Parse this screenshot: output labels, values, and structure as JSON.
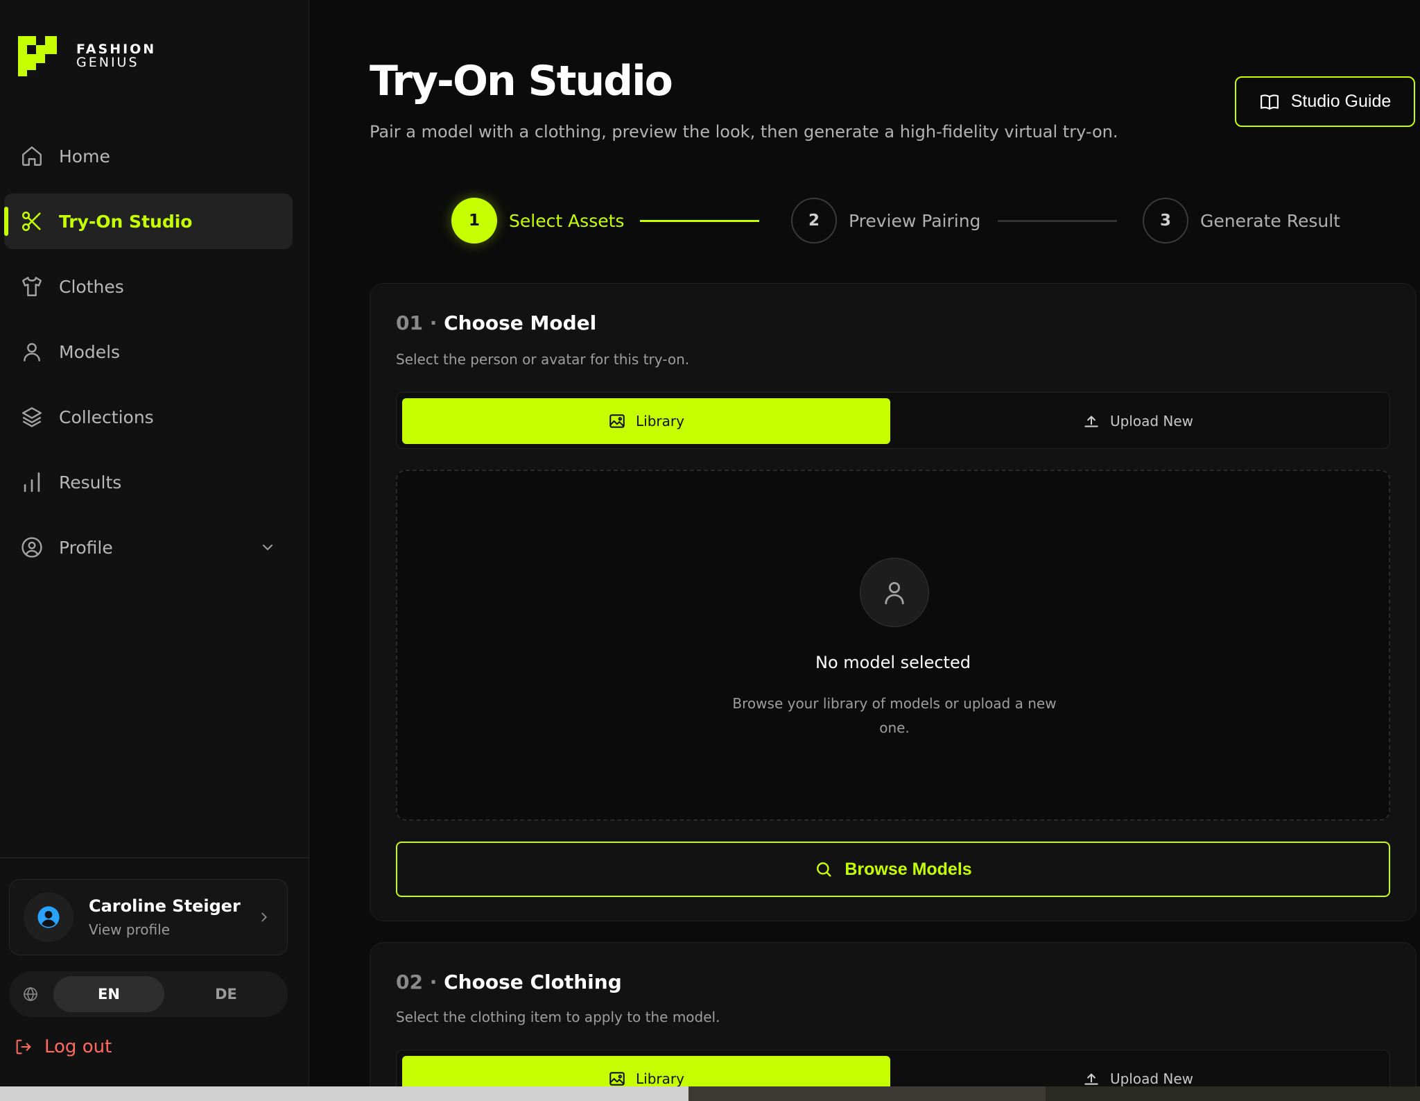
{
  "brand": {
    "line1": "FASHION",
    "line2": "GENIUS",
    "accent": "#c6ff00"
  },
  "sidebar": {
    "items": [
      {
        "label": "Home",
        "icon": "home-icon"
      },
      {
        "label": "Try-On Studio",
        "icon": "scissors-icon",
        "active": true
      },
      {
        "label": "Clothes",
        "icon": "shirt-icon"
      },
      {
        "label": "Models",
        "icon": "user-icon"
      },
      {
        "label": "Collections",
        "icon": "layers-icon"
      },
      {
        "label": "Results",
        "icon": "bar-chart-icon"
      },
      {
        "label": "Profile",
        "icon": "user-circle-icon"
      }
    ],
    "user": {
      "name": "Caroline Steiger",
      "sub": "View profile"
    },
    "lang": {
      "en": "EN",
      "de": "DE",
      "selected": "EN"
    },
    "logout": "Log out"
  },
  "header": {
    "title": "Try-On Studio",
    "subtitle": "Pair a model with a clothing, preview the look, then generate a high-fidelity virtual try-on.",
    "guide_button": "Studio Guide"
  },
  "stepper": {
    "steps": [
      {
        "num": "1",
        "label": "Select Assets",
        "active": true
      },
      {
        "num": "2",
        "label": "Preview Pairing"
      },
      {
        "num": "3",
        "label": "Generate Result"
      }
    ]
  },
  "model_section": {
    "num": "01 ·",
    "title": "Choose Model",
    "desc": "Select the person or avatar for this try-on.",
    "tab_library": "Library",
    "tab_upload": "Upload New",
    "empty_title": "No model selected",
    "empty_desc": "Browse your library of models or upload a new one.",
    "browse_button": "Browse Models"
  },
  "clothing_section": {
    "num": "02 ·",
    "title": "Choose Clothing",
    "desc": "Select the clothing item to apply to the model.",
    "tab_library": "Library",
    "tab_upload": "Upload New"
  }
}
